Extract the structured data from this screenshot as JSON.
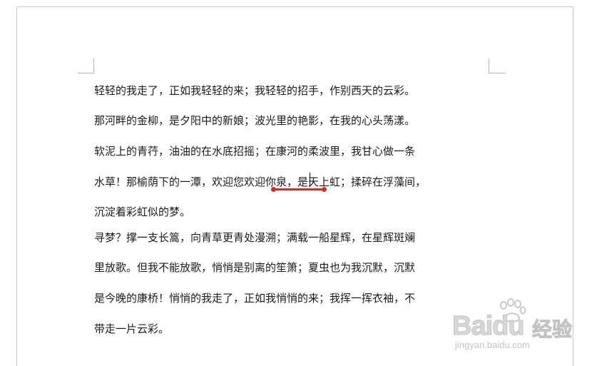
{
  "document": {
    "lines": [
      "轻轻的我走了，正如我轻轻的来；我轻轻的招手，作别西天的云彩。",
      "那河畔的金柳，是夕阳中的新娘；波光里的艳影，在我的心头荡漾。",
      "软泥上的青荇，油油的在水底招摇；在康河的柔波里，我甘心做一条",
      "水草！那榆荫下的一潭，欢迎您欢迎你泉，是天上虹；揉碎在浮藻间，",
      "沉淀着彩虹似的梦。",
      "寻梦？撑一支长篙，向青草更青处漫溯；满载一船星辉，在星辉斑斓",
      "里放歌。但我不能放歌，悄悄是别离的笙箫；夏虫也为我沉默，沉默",
      "是今晚的康桥！悄悄的我走了，正如我悄悄的来；我挥一挥衣袖，不",
      "带走一片云彩。"
    ]
  },
  "annotation": {
    "color": "#d42a2a"
  },
  "watermark": {
    "brand": "Baidu",
    "jingyan": "经验",
    "url": "jingyan.baidu.com",
    "icon": "paw-icon"
  }
}
